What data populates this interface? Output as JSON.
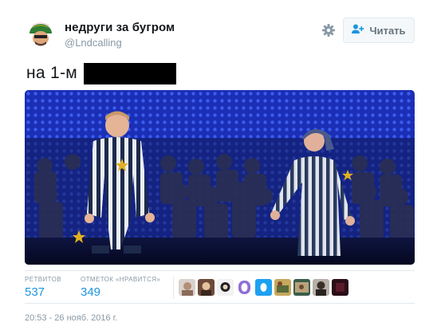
{
  "header": {
    "display_name": "недруги за бугром",
    "handle": "@Lndcalling",
    "follow_label": "Читать",
    "settings_icon": "gear-icon",
    "follow_icon": "person-plus-icon"
  },
  "tweet": {
    "text": "на 1-м"
  },
  "stats": {
    "retweets_label": "РЕТВИТОВ",
    "retweets_value": "537",
    "likes_label": "ОТМЕТОК «НРАВИТСЯ»",
    "likes_value": "349"
  },
  "timestamp": "20:53 - 26 нояб. 2016 г.",
  "colors": {
    "link_blue": "#1b95e0",
    "muted_gray": "#8899a6",
    "stage_blue": "#1a2fb5"
  }
}
